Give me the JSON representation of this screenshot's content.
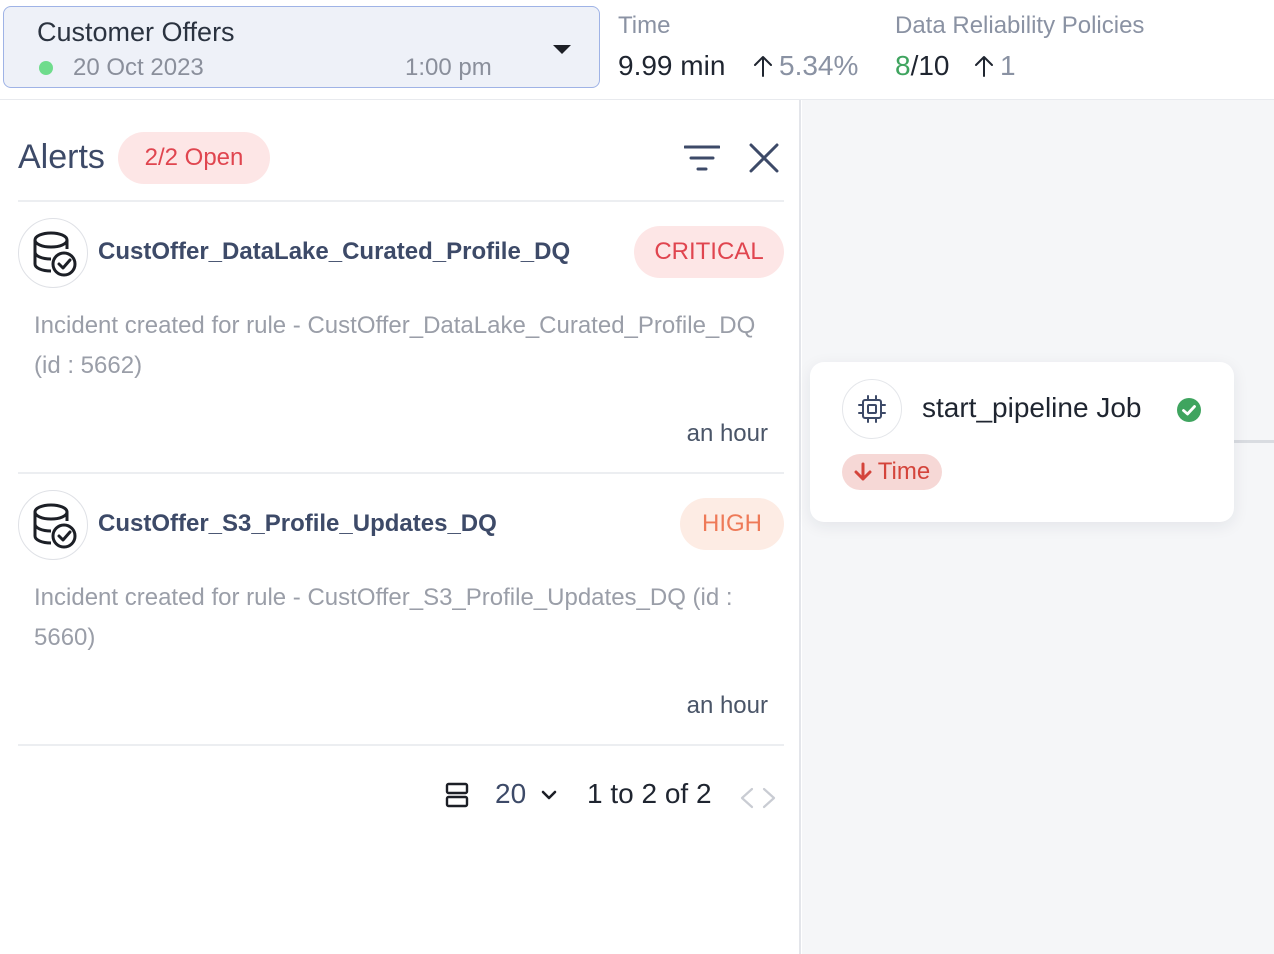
{
  "pipeline": {
    "name": "Customer Offers",
    "date": "20 Oct 2023",
    "time": "1:00 pm",
    "status_color": "#6fdc8c"
  },
  "metrics": {
    "time": {
      "label": "Time",
      "value": "9.99 min",
      "delta": "5.34%",
      "delta_icon": "arrow-up-icon"
    },
    "reliability": {
      "label": "Data Reliability Policies",
      "passed": "8",
      "total": "/10",
      "delta": "1",
      "delta_icon": "arrow-up-icon"
    }
  },
  "alerts": {
    "title": "Alerts",
    "open_badge": "2/2 Open",
    "items": [
      {
        "name": "CustOffer_DataLake_Curated_Profile_DQ",
        "severity": "CRITICAL",
        "description": "Incident created for rule - CustOffer_DataLake_Curated_Profile_DQ (id : 5662)",
        "time": "an hour"
      },
      {
        "name": "CustOffer_S3_Profile_Updates_DQ",
        "severity": "HIGH",
        "description": "Incident created for rule - CustOffer_S3_Profile_Updates_DQ (id : 5660)",
        "time": "an hour"
      }
    ]
  },
  "pagination": {
    "page_size": "20",
    "range": "1 to 2 of 2"
  },
  "job_node": {
    "name": "start_pipeline Job",
    "status": "success",
    "tag": "Time",
    "tag_icon": "arrow-down-icon"
  },
  "colors": {
    "accent_border": "#9fb3e6",
    "critical": "#e0454f",
    "high": "#ee7a58",
    "success": "#3fa45f"
  }
}
